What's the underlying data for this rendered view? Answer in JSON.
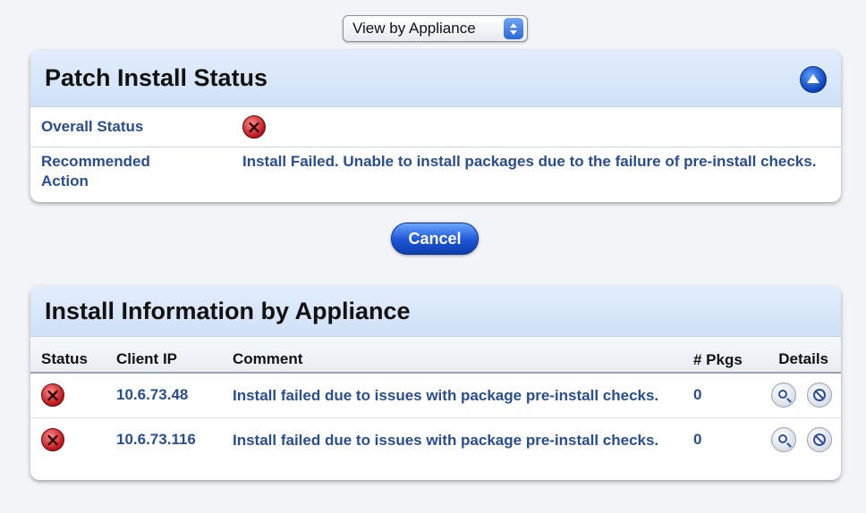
{
  "view_select": {
    "value": "View by Appliance"
  },
  "status_panel": {
    "title": "Patch Install Status",
    "overall_label": "Overall Status",
    "overall_icon": "error-x-icon",
    "action_label": "Recommended Action",
    "action_text": "Install Failed. Unable to install packages due to the failure of pre-install checks."
  },
  "cancel_label": "Cancel",
  "info_panel": {
    "title": "Install Information by Appliance",
    "columns": {
      "status": "Status",
      "client_ip": "Client IP",
      "comment": "Comment",
      "pkgs": "# Pkgs",
      "details": "Details"
    },
    "rows": [
      {
        "status_icon": "error-x-icon",
        "client_ip": "10.6.73.48",
        "comment": "Install failed due to issues with package pre-install checks.",
        "pkgs": "0"
      },
      {
        "status_icon": "error-x-icon",
        "client_ip": "10.6.73.116",
        "comment": "Install failed due to issues with package pre-install checks.",
        "pkgs": "0"
      }
    ]
  },
  "colors": {
    "accent_blue": "#1c55d6",
    "link_text": "#2a4d8f",
    "error_red": "#b8131a",
    "header_bg": "#cfe0f7"
  }
}
